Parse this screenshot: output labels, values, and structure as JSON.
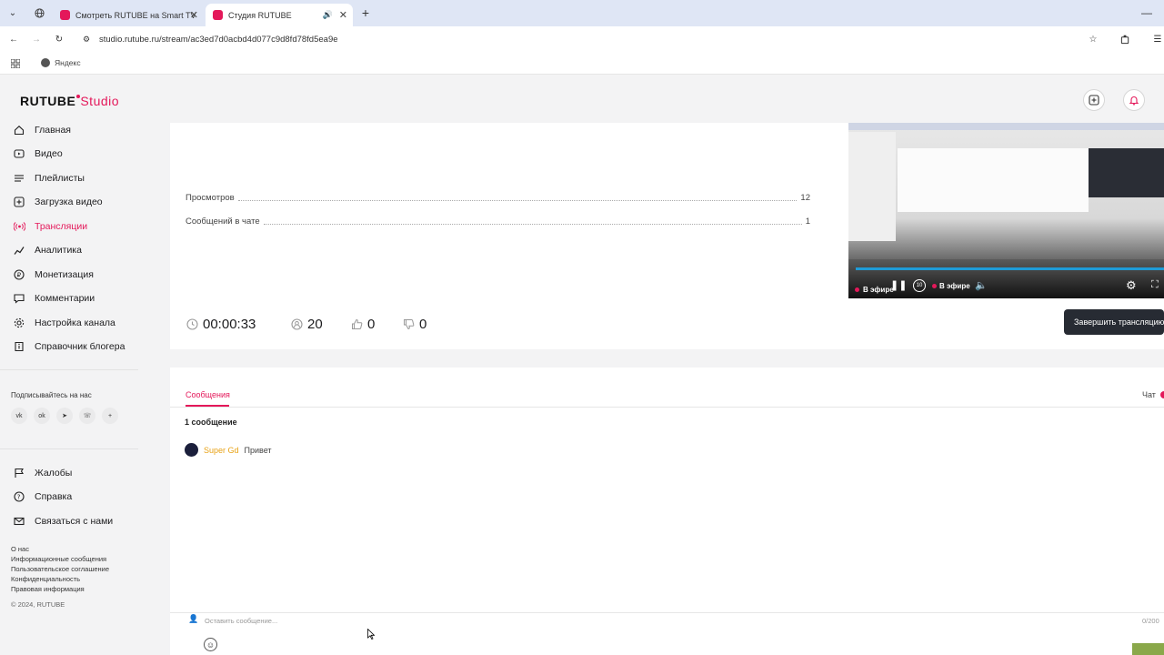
{
  "browser": {
    "tabs": [
      {
        "title": "Смотреть RUTUBE на Smart TV"
      },
      {
        "title": "Студия RUTUBE"
      }
    ],
    "url": "studio.rutube.ru/stream/ac3ed7d0acbd4d077c9d8fd78fd5ea9e",
    "bookmark": "Яндекс"
  },
  "logo": {
    "brand": "RUTUBE",
    "studio": "Studio"
  },
  "sidebar": {
    "items": [
      {
        "label": "Главная",
        "icon": "home-icon"
      },
      {
        "label": "Видео",
        "icon": "video-icon"
      },
      {
        "label": "Плейлисты",
        "icon": "playlist-icon"
      },
      {
        "label": "Загрузка видео",
        "icon": "upload-icon"
      },
      {
        "label": "Трансляции",
        "icon": "broadcast-icon",
        "active": true
      },
      {
        "label": "Аналитика",
        "icon": "analytics-icon"
      },
      {
        "label": "Монетизация",
        "icon": "ruble-icon"
      },
      {
        "label": "Комментарии",
        "icon": "comment-icon"
      },
      {
        "label": "Настройка канала",
        "icon": "gear-icon"
      },
      {
        "label": "Справочник блогера",
        "icon": "info-icon"
      }
    ],
    "subscribe_label": "Подписывайтесь на нас",
    "bottom_items": [
      {
        "label": "Жалобы",
        "icon": "flag-icon"
      },
      {
        "label": "Справка",
        "icon": "help-icon"
      },
      {
        "label": "Связаться с нами",
        "icon": "mail-icon"
      }
    ],
    "links": [
      "О нас",
      "Информационные сообщения",
      "Пользовательское соглашение",
      "Конфиденциальность",
      "Правовая информация"
    ],
    "copyright": "© 2024, RUTUBE"
  },
  "stats": {
    "views_label": "Просмотров",
    "views_value": "12",
    "chat_label": "Сообщений в чате",
    "chat_value": "1"
  },
  "metrics": {
    "duration": "00:00:33",
    "viewers": "20",
    "likes": "0",
    "dislikes": "0"
  },
  "preview": {
    "live_label": "В эфире",
    "live_label_2": "В эфире",
    "end_button": "Завершить трансляцию"
  },
  "chat": {
    "tab_messages": "Сообщения",
    "tab_chat": "Чат",
    "count_label": "1 сообщение",
    "messages": [
      {
        "author": "Super Gd",
        "text": "Привет"
      }
    ],
    "input_placeholder": "Оставить сообщение...",
    "char_counter": "0/200"
  },
  "colors": {
    "accent": "#e4185a",
    "author": "#e8a317"
  }
}
